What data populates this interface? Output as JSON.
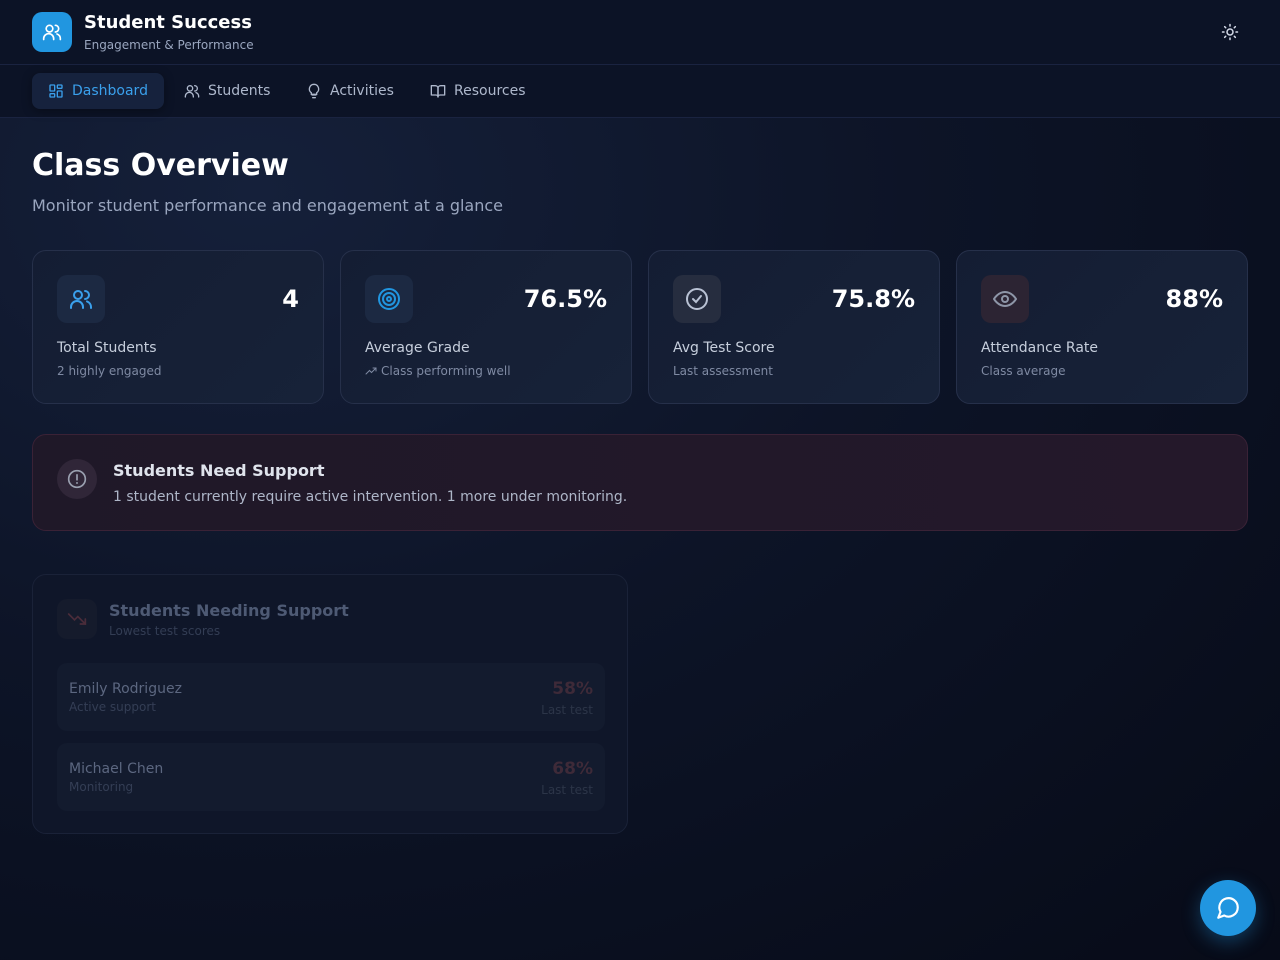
{
  "app": {
    "title": "Student Success",
    "subtitle": "Engagement & Performance"
  },
  "icons": {
    "logo": "users-icon",
    "theme": "sun-icon",
    "chat": "message-circle-icon"
  },
  "nav": {
    "items": [
      {
        "label": "Dashboard",
        "icon": "layout-grid-icon",
        "active": true
      },
      {
        "label": "Students",
        "icon": "users-icon",
        "active": false
      },
      {
        "label": "Activities",
        "icon": "lightbulb-icon",
        "active": false
      },
      {
        "label": "Resources",
        "icon": "book-open-icon",
        "active": false
      }
    ]
  },
  "page": {
    "title": "Class Overview",
    "subtitle": "Monitor student performance and engagement at a glance"
  },
  "stats": [
    {
      "value": "4",
      "label": "Total Students",
      "note": "2 highly engaged",
      "icon": "users-icon",
      "color": "#3aa0ec"
    },
    {
      "value": "76.5%",
      "label": "Average Grade",
      "note": "Class performing well",
      "icon": "target-icon",
      "color": "#2196e0"
    },
    {
      "value": "75.8%",
      "label": "Avg Test Score",
      "note": "Last assessment",
      "icon": "check-circle-icon",
      "color": "#b9c2d4"
    },
    {
      "value": "88%",
      "label": "Attendance Rate",
      "note": "Class average",
      "icon": "eye-icon",
      "color": "#8e96a8"
    }
  ],
  "alert": {
    "title": "Students Need Support",
    "text": "1 student currently require active intervention. 1 more under monitoring.",
    "icon": "alert-circle-icon"
  },
  "support": {
    "title": "Students Needing Support",
    "subtitle": "Lowest test scores",
    "icon": "trending-down-icon",
    "students": [
      {
        "name": "Emily Rodriguez",
        "status": "Active support",
        "score": "58%",
        "score_label": "Last test"
      },
      {
        "name": "Michael Chen",
        "status": "Monitoring",
        "score": "68%",
        "score_label": "Last test"
      }
    ]
  }
}
